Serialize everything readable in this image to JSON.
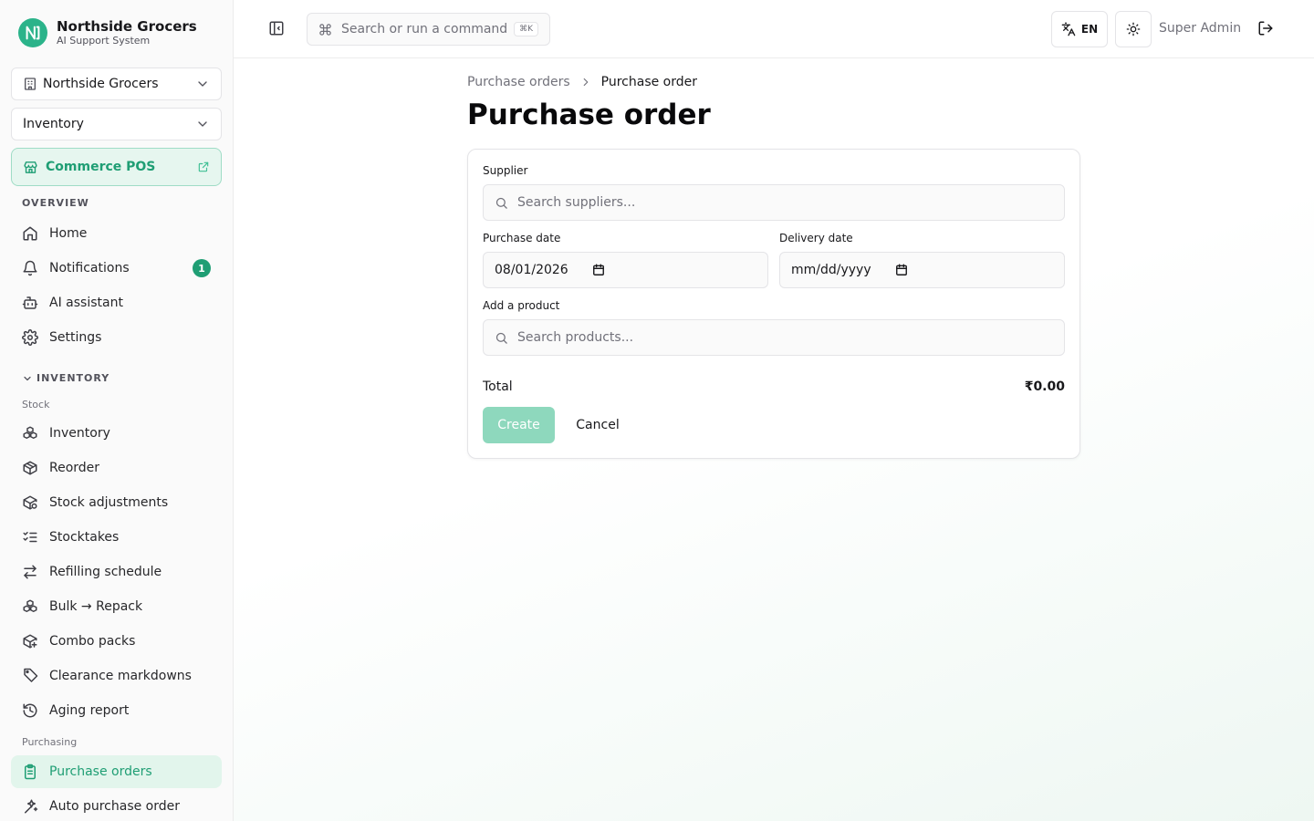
{
  "brand": {
    "name": "Northside Grocers",
    "subtitle": "AI Support System"
  },
  "org_select": {
    "value": "Northside Grocers"
  },
  "module_select": {
    "value": "Inventory"
  },
  "pos_button": {
    "label": "Commerce POS"
  },
  "sidebar": {
    "overview_label": "OVERVIEW",
    "overview_items": [
      {
        "label": "Home",
        "icon": "home-icon"
      },
      {
        "label": "Notifications",
        "icon": "bell-icon",
        "badge": "1"
      },
      {
        "label": "AI assistant",
        "icon": "bot-icon"
      },
      {
        "label": "Settings",
        "icon": "gear-icon"
      }
    ],
    "inventory_label": "INVENTORY",
    "stock_label": "Stock",
    "stock_items": [
      {
        "label": "Inventory",
        "icon": "boxes-icon"
      },
      {
        "label": "Reorder",
        "icon": "package-icon"
      },
      {
        "label": "Stock adjustments",
        "icon": "package-adjust-icon"
      },
      {
        "label": "Stocktakes",
        "icon": "list-checks-icon"
      },
      {
        "label": "Refilling schedule",
        "icon": "arrows-swap-icon"
      },
      {
        "label": "Bulk → Repack",
        "icon": "boxes-icon"
      },
      {
        "label": "Combo packs",
        "icon": "package-plus-icon"
      },
      {
        "label": "Clearance markdowns",
        "icon": "tag-icon"
      },
      {
        "label": "Aging report",
        "icon": "history-icon"
      }
    ],
    "purchasing_label": "Purchasing",
    "purchasing_items": [
      {
        "label": "Purchase orders",
        "icon": "clipboard-list-icon",
        "active": true
      },
      {
        "label": "Auto purchase order",
        "icon": "sparkles-icon"
      }
    ]
  },
  "topbar": {
    "search_placeholder": "Search or run a command",
    "shortcut": "⌘K",
    "language": "EN",
    "user": "Super Admin"
  },
  "breadcrumb": {
    "parent": "Purchase orders",
    "current": "Purchase order"
  },
  "page_title": "Purchase order",
  "form": {
    "supplier_label": "Supplier",
    "supplier_placeholder": "Search suppliers...",
    "purchase_date_label": "Purchase date",
    "purchase_date_value": "08/01/2026",
    "delivery_date_label": "Delivery date",
    "delivery_date_placeholder": "mm/dd/yyyy",
    "product_label": "Add a product",
    "product_placeholder": "Search products...",
    "total_label": "Total",
    "total_value": "₹0.00",
    "create_label": "Create",
    "cancel_label": "Cancel"
  },
  "colors": {
    "accent": "#1f9e74",
    "accent_light": "#e2f5ec",
    "create_disabled": "#8ed8bd"
  }
}
